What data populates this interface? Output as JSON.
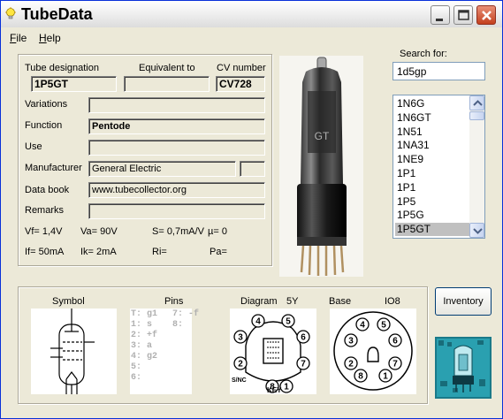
{
  "window": {
    "title": "TubeData"
  },
  "menu": {
    "file": "File",
    "file_ul": "F",
    "file_rest": "ile",
    "help": "Help",
    "help_ul": "H",
    "help_rest": "elp"
  },
  "info": {
    "designation_label": "Tube designation",
    "designation_value": "1P5GT",
    "equivalent_label": "Equivalent to",
    "equivalent_value": "",
    "cv_label": "CV number",
    "cv_value": "CV728",
    "variations_label": "Variations",
    "variations_value": "",
    "function_label": "Function",
    "function_value": "Pentode",
    "use_label": "Use",
    "use_value": "",
    "manufacturer_label": "Manufacturer",
    "manufacturer_value": "General Electric",
    "manufacturer_extra": "",
    "databook_label": "Data book",
    "databook_value": "www.tubecollector.org",
    "remarks_label": "Remarks",
    "remarks_value": "",
    "vf": "Vf= 1,4V",
    "va": "Va=  90V",
    "s": "S= 0,7mA/V",
    "mu": "µ=    0",
    "if": "If= 50mA",
    "ik": "Ik=   2mA",
    "ri": "Ri=",
    "pa": "Pa="
  },
  "search": {
    "label": "Search for:",
    "value": "1d5gp"
  },
  "tube_list": [
    "1N6G",
    "1N6GT",
    "1N51",
    "1NA31",
    "1NE9",
    "1P1",
    "1P1",
    "1P5",
    "1P5G",
    "1P5GT"
  ],
  "selected_index": 9,
  "bottom": {
    "symbol_label": "Symbol",
    "pins_label": "Pins",
    "diagram_label": "Diagram",
    "diagram_code": "5Y",
    "base_label": "Base",
    "base_code": "IO8",
    "pins_col1": [
      "T: g1",
      "1: s",
      "2: +f",
      "3: a",
      "4: g2",
      "5:",
      "6:"
    ],
    "pins_col2": [
      "7: -f",
      "8:"
    ],
    "diagram_pins": [
      "1",
      "2",
      "3",
      "4",
      "5",
      "6",
      "7",
      "8"
    ],
    "diagram_note_left": "S/NC",
    "diagram_note_key": "KEY",
    "base_pins": [
      "1",
      "2",
      "3",
      "4",
      "5",
      "6",
      "7",
      "8"
    ]
  },
  "inventory_label": "Inventory",
  "colors": {
    "title_accent": "#0831d9",
    "selected_row": "#c0c0c0",
    "close_button": "#c4401e"
  }
}
